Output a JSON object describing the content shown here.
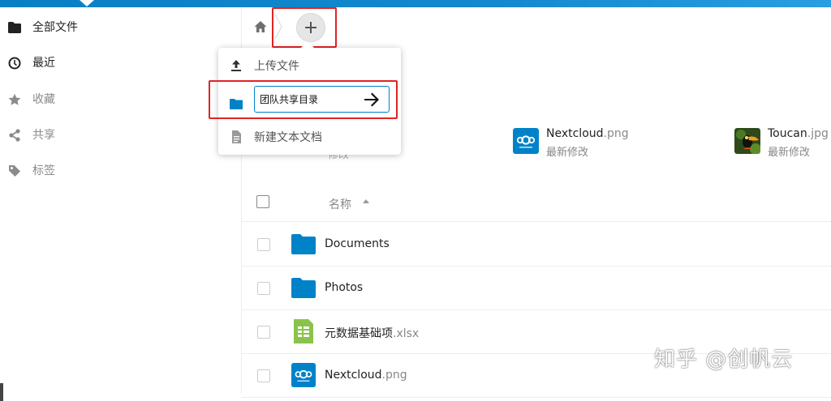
{
  "sidebar": {
    "items": [
      {
        "label": "全部文件",
        "icon": "folder-icon"
      },
      {
        "label": "最近",
        "icon": "clock-icon"
      },
      {
        "label": "收藏",
        "icon": "star-icon"
      },
      {
        "label": "共享",
        "icon": "share-icon"
      },
      {
        "label": "标签",
        "icon": "tag-icon"
      }
    ]
  },
  "breadcrumb": {
    "home_icon": "home-icon",
    "add_icon": "plus-icon"
  },
  "new_menu": {
    "items": [
      {
        "label": "上传文件",
        "icon": "upload-icon"
      },
      {
        "label": "团队共享目录",
        "icon": "folder-icon",
        "editing": true
      },
      {
        "label": "新建文本文档",
        "icon": "text-file-icon"
      }
    ],
    "confirm_icon": "arrow-right-icon"
  },
  "recent": {
    "hidden_label_1": "...",
    "hidden_label_2": "修改",
    "items": [
      {
        "name": "Nextcloud",
        "ext": ".png",
        "sub": "最新修改"
      },
      {
        "name": "Toucan",
        "ext": ".jpg",
        "sub": "最新修改"
      }
    ]
  },
  "file_list": {
    "column_name": "名称",
    "rows": [
      {
        "name": "Documents",
        "ext": "",
        "type": "folder"
      },
      {
        "name": "Photos",
        "ext": "",
        "type": "folder"
      },
      {
        "name": "元数据基础项",
        "ext": ".xlsx",
        "type": "spreadsheet"
      },
      {
        "name": "Nextcloud",
        "ext": ".png",
        "type": "image"
      }
    ]
  },
  "colors": {
    "accent": "#0082c9",
    "highlight": "#e02424",
    "spreadsheet": "#8bc34a"
  },
  "watermark": "知乎 @创帆云"
}
